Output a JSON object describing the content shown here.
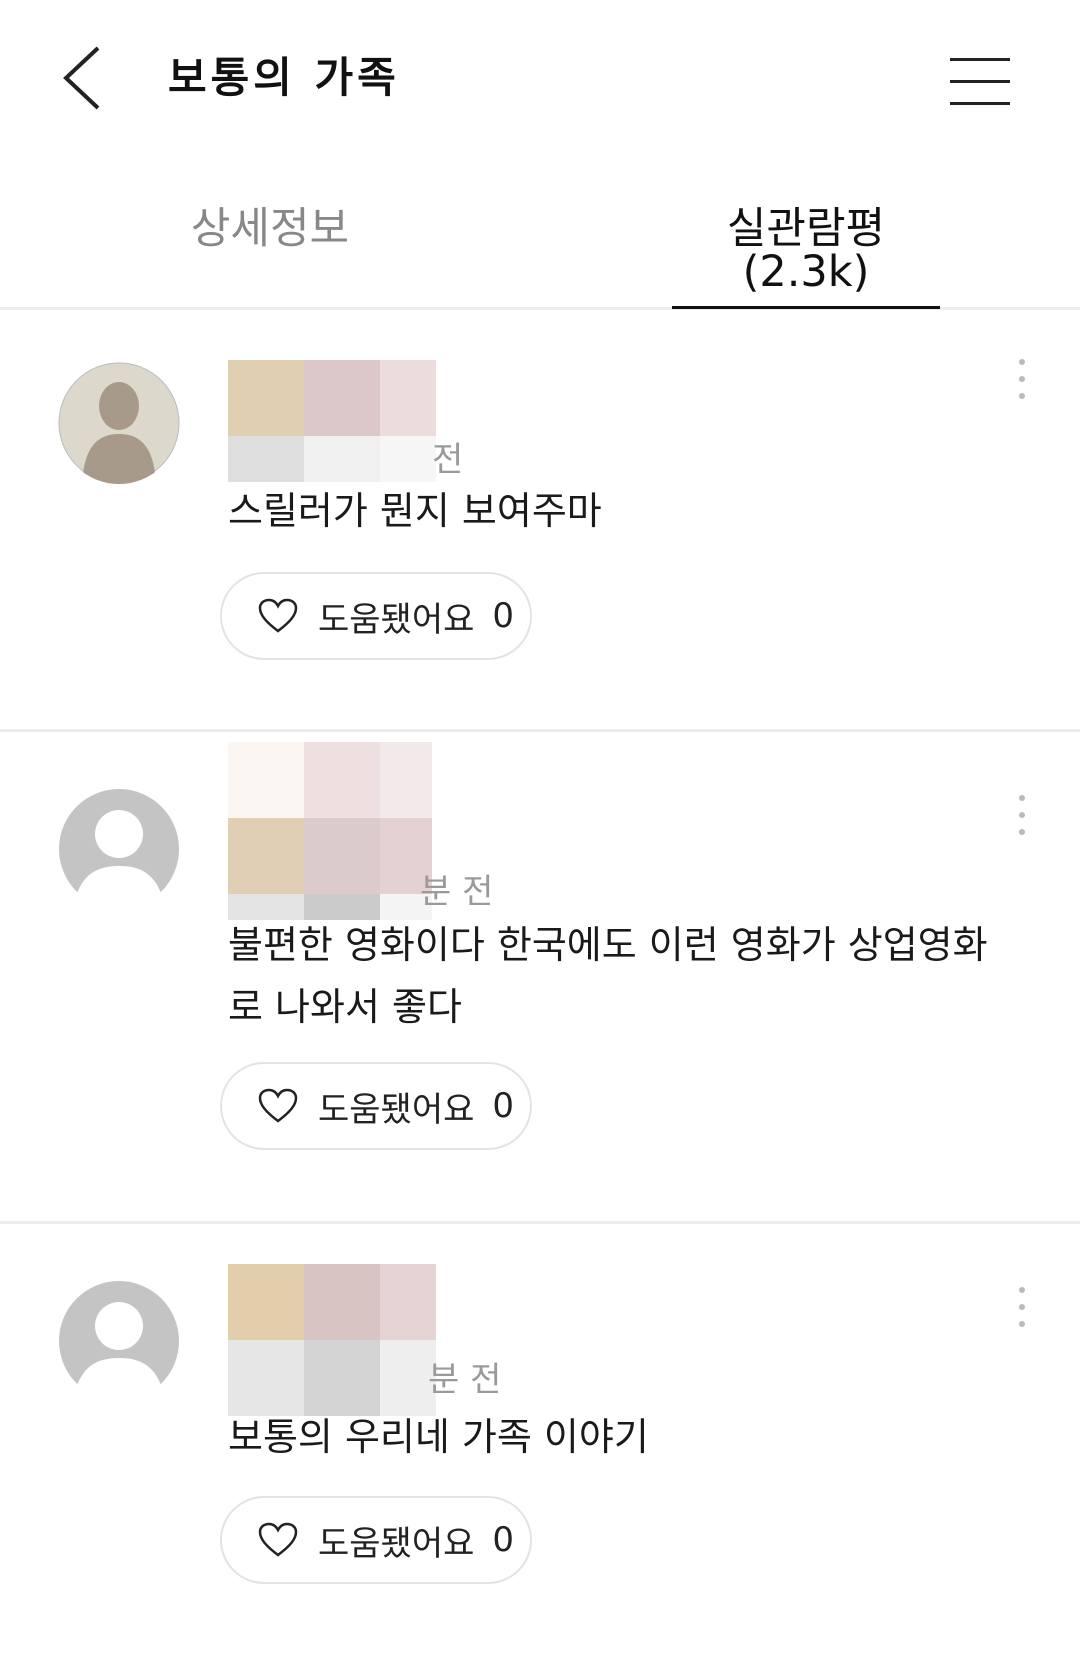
{
  "header": {
    "title": "보통의 가족",
    "back_icon": "chevron-left-icon",
    "menu_icon": "hamburger-menu-icon"
  },
  "tabs": [
    {
      "label": "상세정보",
      "active": false
    },
    {
      "label": "실관람평(2.3k)",
      "active": true
    }
  ],
  "reviews": [
    {
      "time": "전",
      "comment": "스릴러가 뭔지 보여주마",
      "helpful_label": "도움됐어요",
      "helpful_count": "0"
    },
    {
      "time": "분 전",
      "comment": "불편한 영화이다 한국에도 이런 영화가 상업영화로 나와서 좋다",
      "helpful_label": "도움됐어요",
      "helpful_count": "0"
    },
    {
      "time": "분 전",
      "comment": "보통의 우리네 가족 이야기",
      "helpful_label": "도움됐어요",
      "helpful_count": "0"
    }
  ],
  "colors": {
    "accent": "#111111",
    "muted": "#9a9a9a",
    "divider": "#ececec"
  }
}
